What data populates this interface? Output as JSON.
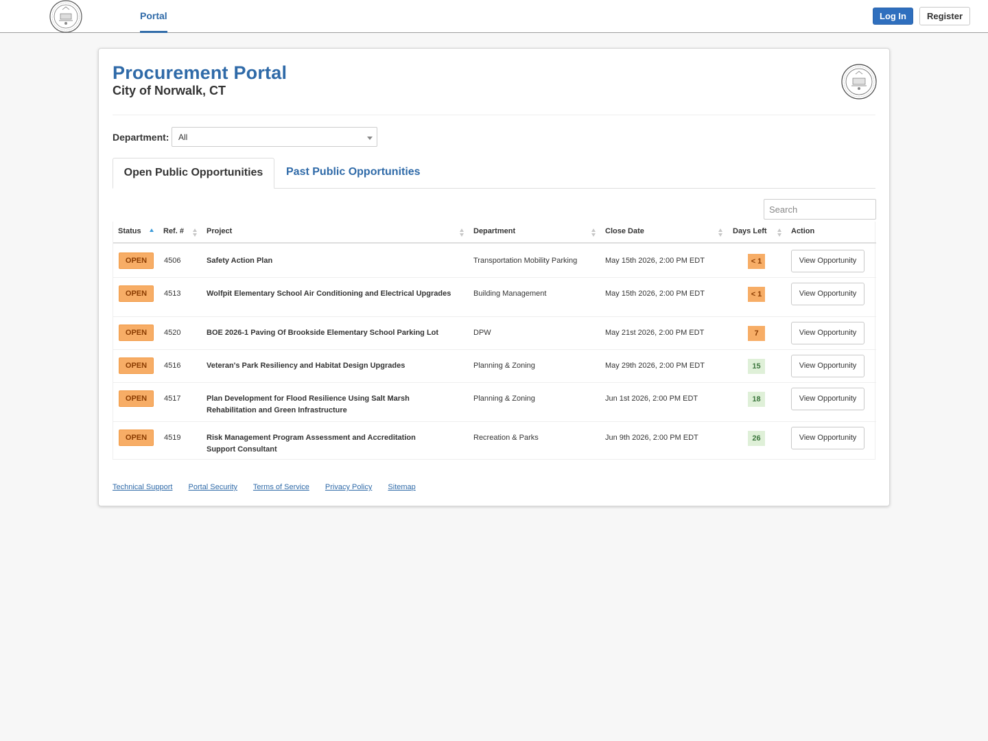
{
  "header": {
    "nav_portal": "Portal",
    "login_label": "Log In",
    "register_label": "Register"
  },
  "page": {
    "title": "Procurement Portal",
    "subtitle": "City of Norwalk, CT"
  },
  "filter": {
    "department_label": "Department:",
    "department_value": "All"
  },
  "tabs": {
    "open": "Open Public Opportunities",
    "past": "Past Public Opportunities"
  },
  "search": {
    "placeholder": "Search"
  },
  "table": {
    "headers": {
      "status": "Status",
      "ref": "Ref. #",
      "project": "Project",
      "department": "Department",
      "close_date": "Close Date",
      "days_left": "Days Left",
      "action": "Action"
    },
    "rows": [
      {
        "status": "OPEN",
        "ref": "4506",
        "project": "Safety Action Plan",
        "department": "Transportation Mobility Parking",
        "close_date": "May 15th 2026, 2:00 PM EDT",
        "days_left": "< 1",
        "action": "View Opportunity"
      },
      {
        "status": "OPEN",
        "ref": "4513",
        "project": "Wolfpit Elementary School Air Conditioning and Electrical Upgrades",
        "department": "Building Management",
        "close_date": "May 15th 2026, 2:00 PM EDT",
        "days_left": "< 1",
        "action": "View Opportunity"
      },
      {
        "status": "OPEN",
        "ref": "4520",
        "project": "BOE 2026-1 Paving Of Brookside Elementary School Parking Lot",
        "department": "DPW",
        "close_date": "May 21st 2026, 2:00 PM EDT",
        "days_left": "7",
        "action": "View Opportunity"
      },
      {
        "status": "OPEN",
        "ref": "4516",
        "project": "Veteran's Park Resiliency and Habitat Design Upgrades",
        "department": "Planning & Zoning",
        "close_date": "May 29th 2026, 2:00 PM EDT",
        "days_left": "15",
        "action": "View Opportunity"
      },
      {
        "status": "OPEN",
        "ref": "4517",
        "project": "Plan Development for Flood Resilience Using Salt Marsh Rehabilitation and Green Infrastructure",
        "department": "Planning & Zoning",
        "close_date": "Jun 1st 2026, 2:00 PM EDT",
        "days_left": "18",
        "action": "View Opportunity"
      },
      {
        "status": "OPEN",
        "ref": "4519",
        "project": "Risk Management Program Assessment and Accreditation Support Consultant",
        "department": "Recreation & Parks",
        "close_date": "Jun 9th 2026, 2:00 PM EDT",
        "days_left": "26",
        "action": "View Opportunity"
      }
    ]
  },
  "footer": {
    "links": [
      "Technical Support",
      "Portal Security",
      "Terms of Service",
      "Privacy Policy",
      "Sitemap"
    ]
  },
  "icons": {
    "header_logo": "city-seal-icon",
    "card_logo": "city-seal-icon",
    "sort": "sort-caret-icon"
  },
  "colors": {
    "brand_blue": "#2f6aa8",
    "open_badge": "#f7ad66",
    "days_ok": "#dff0d8"
  }
}
